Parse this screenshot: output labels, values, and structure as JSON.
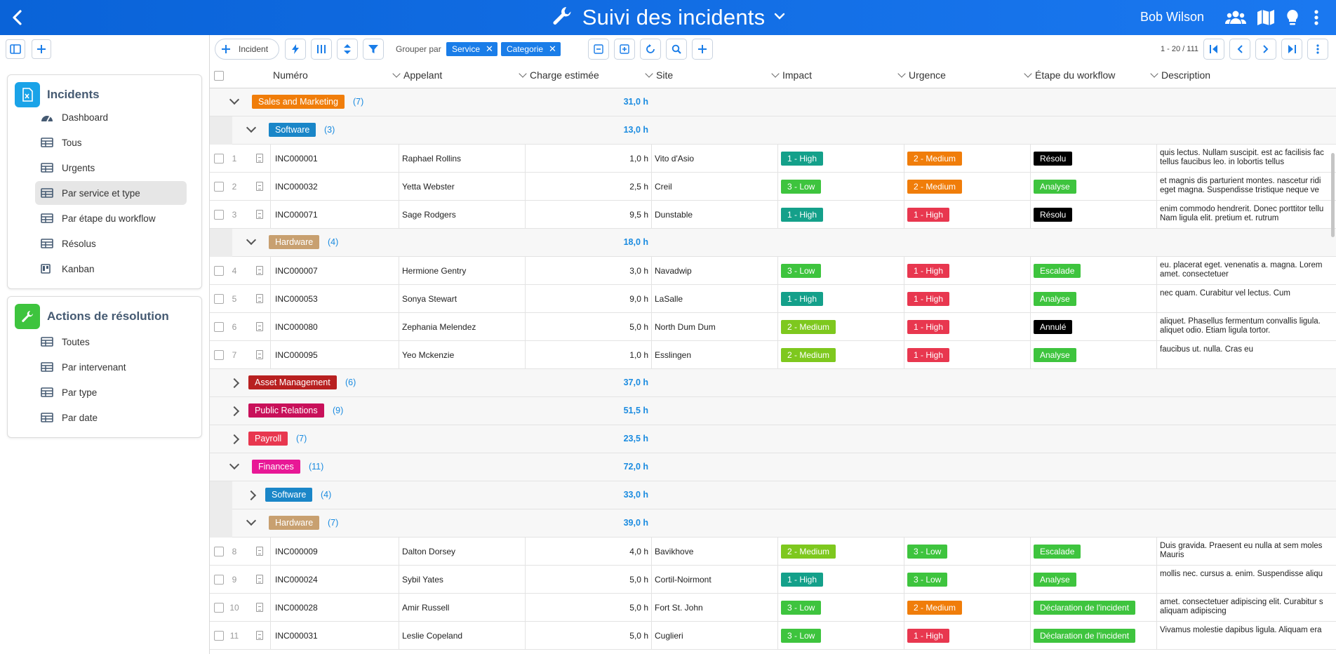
{
  "header": {
    "title": "Suivi des incidents",
    "user": "Bob Wilson",
    "icons": [
      "back-icon",
      "wrench-icon",
      "chevron-down-icon",
      "users-icon",
      "map-icon",
      "lightbulb-icon",
      "more-vert-icon"
    ]
  },
  "colors": {
    "brand": "#1170e4",
    "accent_link": "#1a8be0",
    "chip": "#1a7de8"
  },
  "sidebar": {
    "panels": [
      {
        "title": "Incidents",
        "icon": "excel-file-icon",
        "items": [
          {
            "label": "Dashboard",
            "icon": "dashboard-icon"
          },
          {
            "label": "Tous",
            "icon": "table-icon"
          },
          {
            "label": "Urgents",
            "icon": "table-icon"
          },
          {
            "label": "Par service et type",
            "icon": "table-icon",
            "active": true
          },
          {
            "label": "Par étape du workflow",
            "icon": "table-icon"
          },
          {
            "label": "Résolus",
            "icon": "table-icon"
          },
          {
            "label": "Kanban",
            "icon": "kanban-icon"
          }
        ]
      },
      {
        "title": "Actions de résolution",
        "icon": "wrench-icon",
        "items": [
          {
            "label": "Toutes",
            "icon": "table-icon"
          },
          {
            "label": "Par intervenant",
            "icon": "table-icon"
          },
          {
            "label": "Par type",
            "icon": "table-icon"
          },
          {
            "label": "Par date",
            "icon": "table-icon"
          }
        ]
      }
    ]
  },
  "toolbar": {
    "new_label": "Incident",
    "group_by_label": "Grouper par",
    "group_chips": [
      "Service",
      "Categorie"
    ],
    "pager": "1 - 20 / 111"
  },
  "columns": [
    "Numéro",
    "Appelant",
    "Charge estimée",
    "Site",
    "Impact",
    "Urgence",
    "Étape du workflow",
    "Description"
  ],
  "rows": [
    {
      "kind": "group",
      "level": 1,
      "expanded": true,
      "label": "Sales and Marketing",
      "color": "#f07d0a",
      "count": "(7)",
      "sum": "31,0 h"
    },
    {
      "kind": "group",
      "level": 2,
      "expanded": true,
      "label": "Software",
      "color": "#1a86c8",
      "count": "(3)",
      "sum": "13,0 h"
    },
    {
      "kind": "data",
      "n": "1",
      "num": "INC000001",
      "caller": "Raphael Rollins",
      "charge": "1,0 h",
      "site": "Vito d'Asio",
      "impact": "1 - High",
      "impact_color": "#14a08a",
      "urgence": "2 - Medium",
      "urgence_color": "#f07d0a",
      "etape": "Résolu",
      "etape_color": "#000000",
      "desc": "quis lectus. Nullam suscipit. est ac facilisis fac tellus faucibus leo. in lobortis tellus"
    },
    {
      "kind": "data",
      "n": "2",
      "num": "INC000032",
      "caller": "Yetta Webster",
      "charge": "2,5 h",
      "site": "Creil",
      "impact": "3 - Low",
      "impact_color": "#3ec43e",
      "urgence": "2 - Medium",
      "urgence_color": "#f07d0a",
      "etape": "Analyse",
      "etape_color": "#3ec43e",
      "desc": "et magnis dis parturient montes. nascetur ridi eget magna. Suspendisse tristique neque ve"
    },
    {
      "kind": "data",
      "n": "3",
      "num": "INC000071",
      "caller": "Sage Rodgers",
      "charge": "9,5 h",
      "site": "Dunstable",
      "impact": "1 - High",
      "impact_color": "#14a08a",
      "urgence": "1 - High",
      "urgence_color": "#e8374f",
      "etape": "Résolu",
      "etape_color": "#000000",
      "desc": "enim commodo hendrerit. Donec porttitor tellu Nam ligula elit. pretium et. rutrum"
    },
    {
      "kind": "group",
      "level": 2,
      "expanded": true,
      "label": "Hardware",
      "color": "#c8a070",
      "count": "(4)",
      "sum": "18,0 h"
    },
    {
      "kind": "data",
      "n": "4",
      "num": "INC000007",
      "caller": "Hermione Gentry",
      "charge": "3,0 h",
      "site": "Navadwip",
      "impact": "3 - Low",
      "impact_color": "#3ec43e",
      "urgence": "1 - High",
      "urgence_color": "#e8374f",
      "etape": "Escalade",
      "etape_color": "#3ec43e",
      "desc": "eu. placerat eget. venenatis a. magna. Lorem amet. consectetuer"
    },
    {
      "kind": "data",
      "n": "5",
      "num": "INC000053",
      "caller": "Sonya Stewart",
      "charge": "9,0 h",
      "site": "LaSalle",
      "impact": "1 - High",
      "impact_color": "#14a08a",
      "urgence": "1 - High",
      "urgence_color": "#e8374f",
      "etape": "Analyse",
      "etape_color": "#3ec43e",
      "desc": "nec quam. Curabitur vel lectus. Cum"
    },
    {
      "kind": "data",
      "n": "6",
      "num": "INC000080",
      "caller": "Zephania Melendez",
      "charge": "5,0 h",
      "site": "North Dum Dum",
      "impact": "2 - Medium",
      "impact_color": "#7ec81e",
      "urgence": "1 - High",
      "urgence_color": "#e8374f",
      "etape": "Annulé",
      "etape_color": "#000000",
      "desc": "aliquet. Phasellus fermentum convallis ligula. aliquet odio. Etiam ligula tortor."
    },
    {
      "kind": "data",
      "n": "7",
      "num": "INC000095",
      "caller": "Yeo Mckenzie",
      "charge": "1,0 h",
      "site": "Esslingen",
      "impact": "2 - Medium",
      "impact_color": "#7ec81e",
      "urgence": "1 - High",
      "urgence_color": "#e8374f",
      "etape": "Analyse",
      "etape_color": "#3ec43e",
      "desc": "faucibus ut. nulla. Cras eu"
    },
    {
      "kind": "group",
      "level": 1,
      "expanded": false,
      "label": "Asset Management",
      "color": "#b82020",
      "count": "(6)",
      "sum": "37,0 h"
    },
    {
      "kind": "group",
      "level": 1,
      "expanded": false,
      "label": "Public Relations",
      "color": "#c8105a",
      "count": "(9)",
      "sum": "51,5 h"
    },
    {
      "kind": "group",
      "level": 1,
      "expanded": false,
      "label": "Payroll",
      "color": "#e8374f",
      "count": "(7)",
      "sum": "23,5 h"
    },
    {
      "kind": "group",
      "level": 1,
      "expanded": true,
      "label": "Finances",
      "color": "#e81896",
      "count": "(11)",
      "sum": "72,0 h"
    },
    {
      "kind": "group",
      "level": 2,
      "expanded": false,
      "label": "Software",
      "color": "#1a86c8",
      "count": "(4)",
      "sum": "33,0 h"
    },
    {
      "kind": "group",
      "level": 2,
      "expanded": true,
      "label": "Hardware",
      "color": "#c8a070",
      "count": "(7)",
      "sum": "39,0 h"
    },
    {
      "kind": "data",
      "n": "8",
      "num": "INC000009",
      "caller": "Dalton Dorsey",
      "charge": "4,0 h",
      "site": "Bavikhove",
      "impact": "2 - Medium",
      "impact_color": "#7ec81e",
      "urgence": "3 - Low",
      "urgence_color": "#3ec43e",
      "etape": "Escalade",
      "etape_color": "#3ec43e",
      "desc": "Duis gravida. Praesent eu nulla at sem moles Mauris"
    },
    {
      "kind": "data",
      "n": "9",
      "num": "INC000024",
      "caller": "Sybil Yates",
      "charge": "5,0 h",
      "site": "Cortil-Noirmont",
      "impact": "1 - High",
      "impact_color": "#14a08a",
      "urgence": "3 - Low",
      "urgence_color": "#3ec43e",
      "etape": "Analyse",
      "etape_color": "#3ec43e",
      "desc": "mollis nec. cursus a. enim. Suspendisse aliqu"
    },
    {
      "kind": "data",
      "n": "10",
      "num": "INC000028",
      "caller": "Amir Russell",
      "charge": "5,0 h",
      "site": "Fort St. John",
      "impact": "3 - Low",
      "impact_color": "#3ec43e",
      "urgence": "2 - Medium",
      "urgence_color": "#f07d0a",
      "etape": "Déclaration de l'incident",
      "etape_color": "#3ec43e",
      "desc": "amet. consectetuer adipiscing elit. Curabitur s aliquam adipiscing"
    },
    {
      "kind": "data",
      "n": "11",
      "num": "INC000031",
      "caller": "Leslie Copeland",
      "charge": "5,0 h",
      "site": "Cuglieri",
      "impact": "3 - Low",
      "impact_color": "#3ec43e",
      "urgence": "1 - High",
      "urgence_color": "#e8374f",
      "etape": "Déclaration de l'incident",
      "etape_color": "#3ec43e",
      "desc": "Vivamus molestie dapibus ligula. Aliquam era"
    }
  ]
}
